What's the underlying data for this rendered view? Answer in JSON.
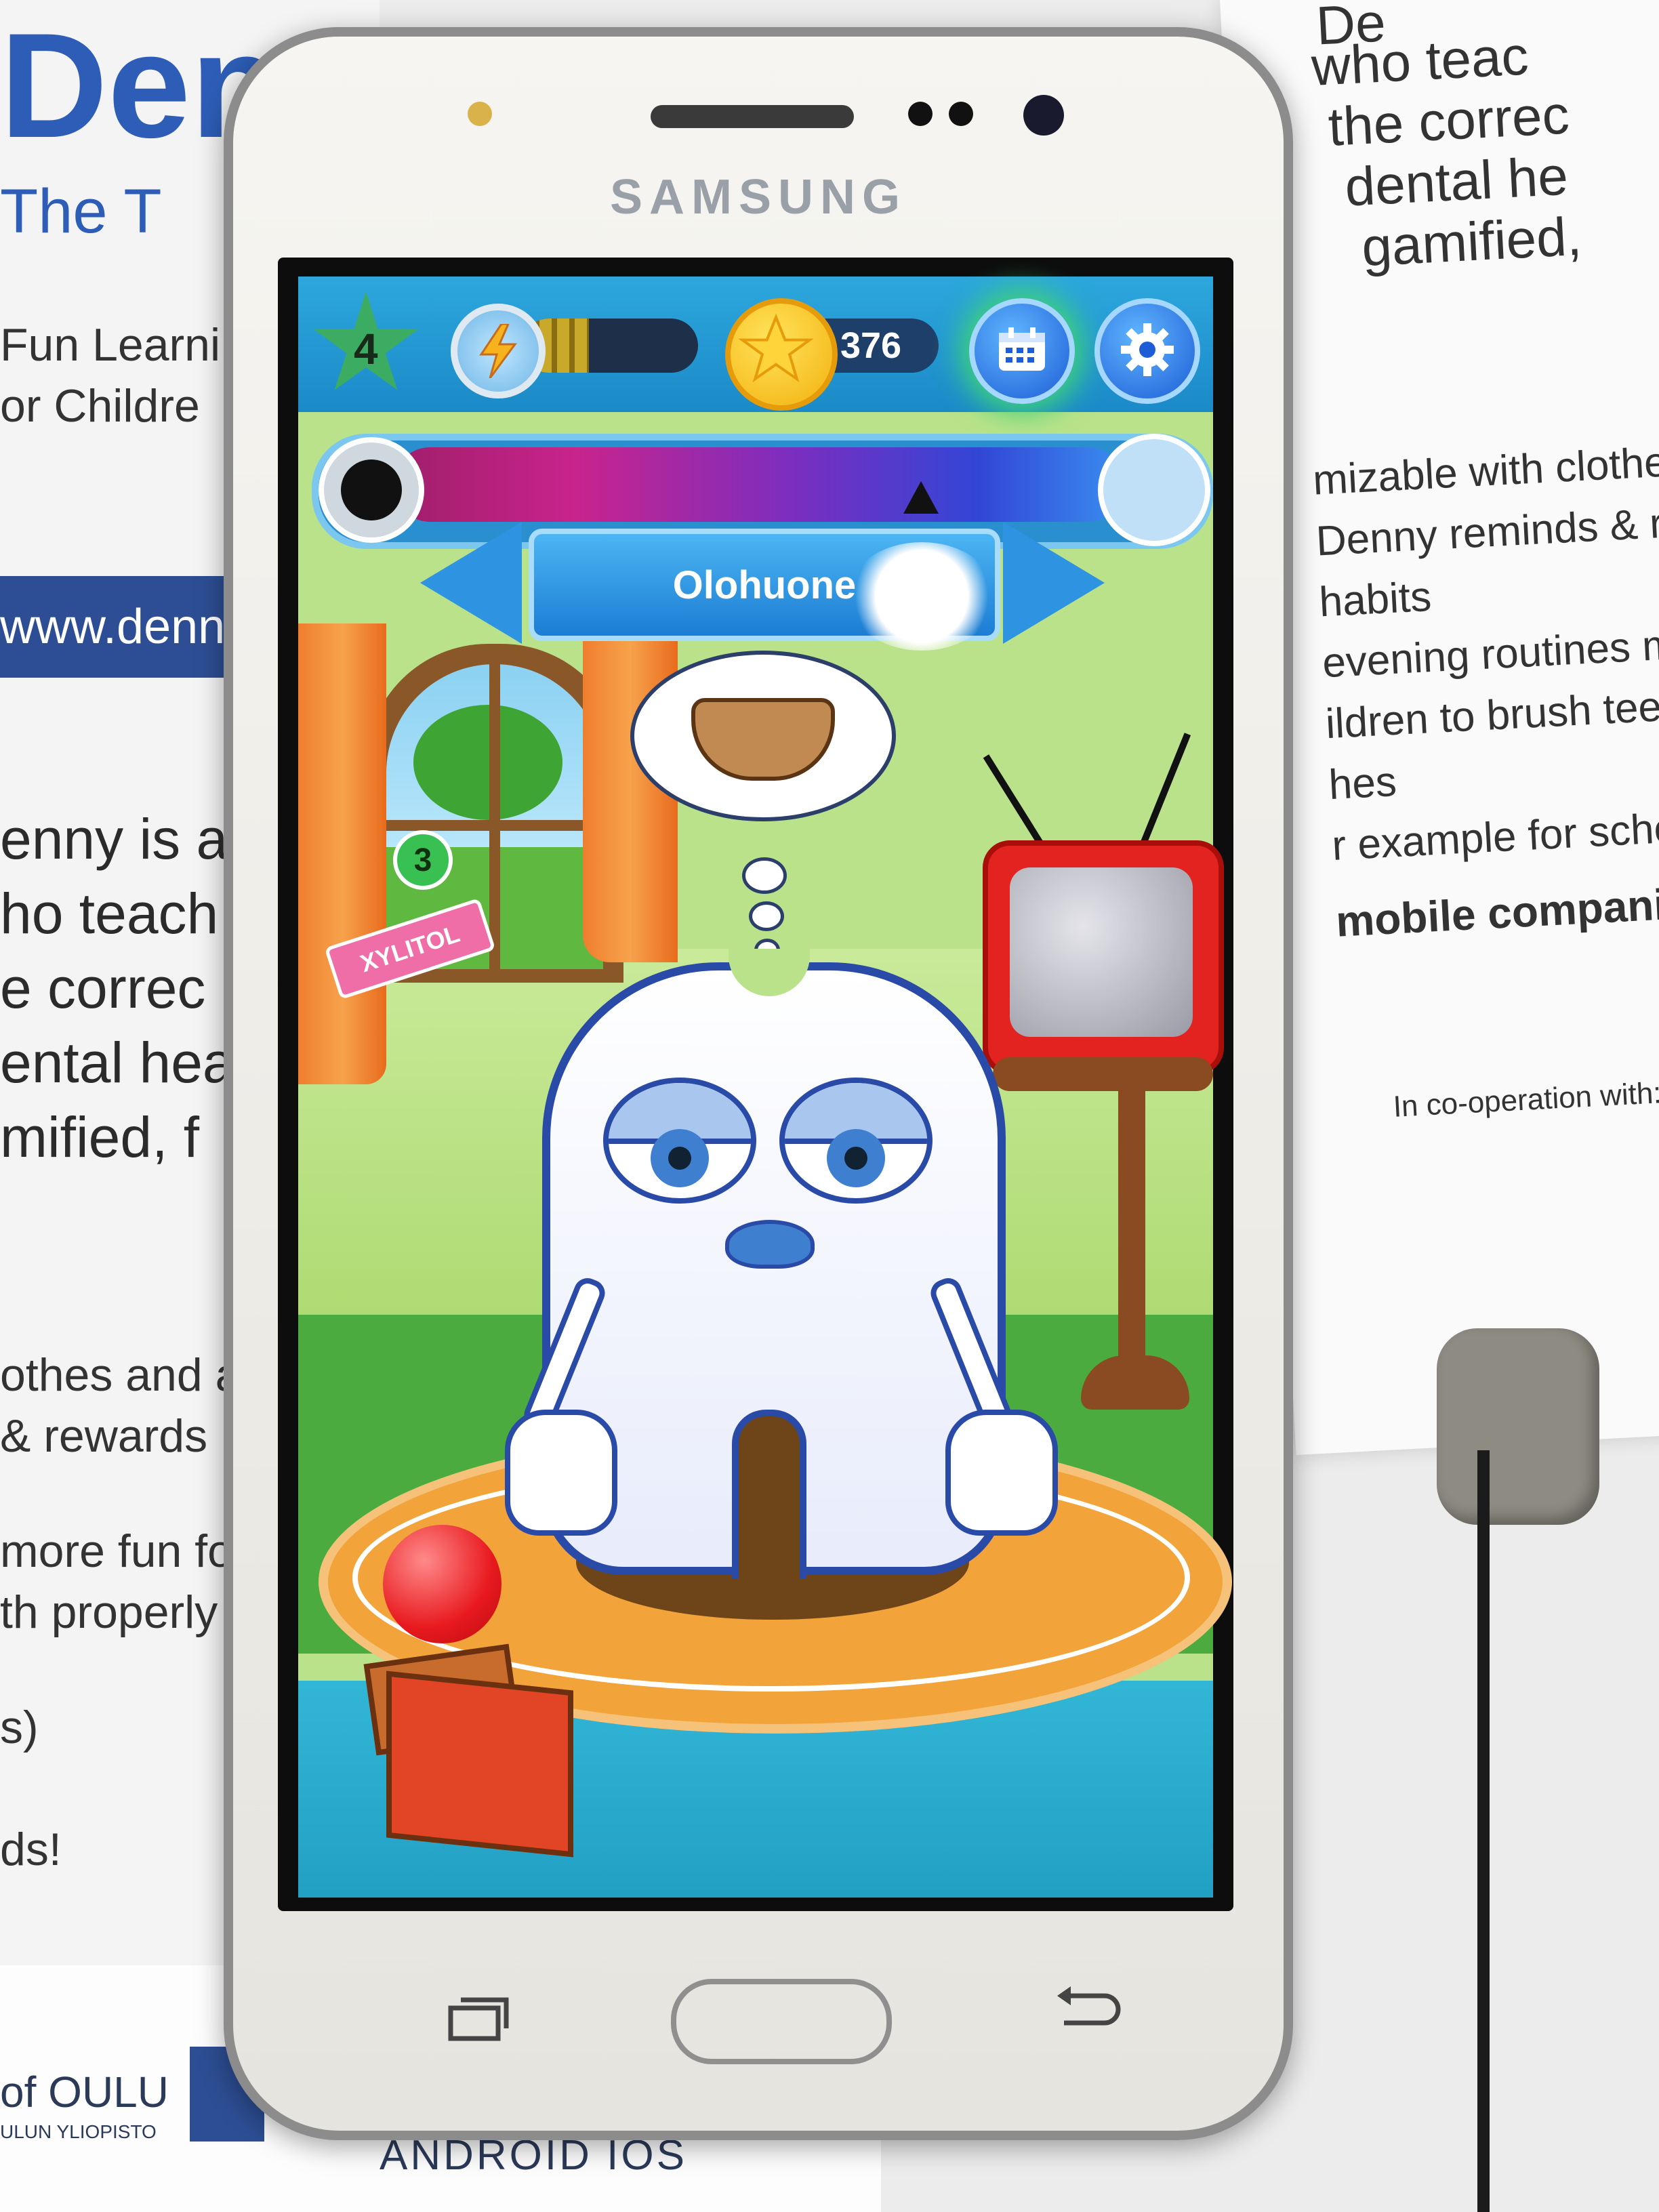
{
  "poster_left": {
    "title": "Den",
    "subtitle": "The T",
    "lines": [
      "Fun Learni",
      "or Childre"
    ],
    "url": "www.denn",
    "body": [
      "enny is a",
      "ho teach",
      "e correc",
      "ental hea",
      "mified, f"
    ],
    "body2": [
      "othes and a",
      "& rewards"
    ],
    "body3": [
      "more fun fo",
      "th properly",
      "s)",
      "ds!"
    ]
  },
  "poster_right": {
    "lines_top": [
      "De",
      "who teac",
      "the correc",
      "dental he",
      "gamified,"
    ],
    "lines_mid": [
      "mizable with clothes",
      "Denny reminds & rew",
      "habits",
      "evening routines mo",
      "ildren to brush teet",
      "hes",
      "r example for scho",
      "mobile companion fo"
    ],
    "cooperation": "In co-operation with:  UI"
  },
  "poster_bottom": {
    "university": "of OULU",
    "university_sub": "ULUN YLIOPISTO",
    "platforms": "ANDROID  IOS"
  },
  "phone": {
    "brand": "SAMSUNG"
  },
  "app": {
    "level": "4",
    "energy_fraction": 0.38,
    "coins": "376",
    "room_name": "Olohuone",
    "hygiene_level": 0.82,
    "xylitol_count": "3",
    "xylitol_label": "XYLITOL",
    "icons": {
      "level": "star-icon",
      "energy": "lightning-icon",
      "coin": "coin-star-icon",
      "calendar": "calendar-icon",
      "settings": "gear-icon",
      "germ": "germ-icon",
      "tooth": "tooth-icon"
    },
    "colors": {
      "topbar": "#1b8ac8",
      "star": "#3dac63",
      "coin": "#f3b10f",
      "calendar_glow": "#3ed27a"
    }
  }
}
